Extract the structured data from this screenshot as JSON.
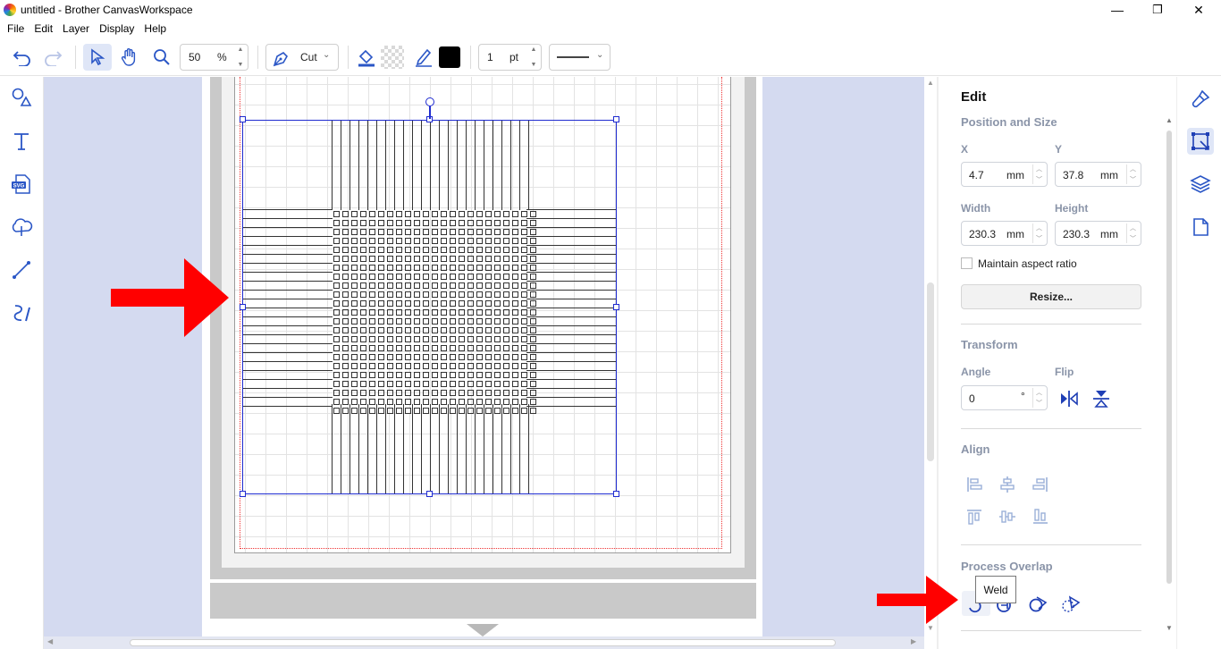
{
  "window": {
    "title": "untitled - Brother CanvasWorkspace",
    "minimize": "—",
    "restore": "❐",
    "close": "✕"
  },
  "menu": [
    "File",
    "Edit",
    "Layer",
    "Display",
    "Help"
  ],
  "toolbar": {
    "zoom_value": "50",
    "zoom_unit": "%",
    "mode_label": "Cut",
    "line_width_value": "1",
    "line_width_unit": "pt",
    "line_color": "#000000"
  },
  "edit_panel": {
    "title": "Edit",
    "position_size": {
      "title": "Position and Size",
      "x_label": "X",
      "x_value": "4.7",
      "x_unit": "mm",
      "y_label": "Y",
      "y_value": "37.8",
      "y_unit": "mm",
      "width_label": "Width",
      "width_value": "230.3",
      "width_unit": "mm",
      "height_label": "Height",
      "height_value": "230.3",
      "height_unit": "mm",
      "aspect_label": "Maintain aspect ratio",
      "resize_label": "Resize..."
    },
    "transform": {
      "title": "Transform",
      "angle_label": "Angle",
      "angle_value": "0",
      "angle_unit": "°",
      "flip_label": "Flip"
    },
    "align": {
      "title": "Align"
    },
    "process_overlap": {
      "title": "Process Overlap",
      "tooltip": "Weld"
    },
    "colors": {
      "accent": "#1f3fb5",
      "disabled": "#9bb0d8",
      "selection": "#1f2bd0",
      "annotation_arrow": "#ff0000"
    }
  },
  "icons": {
    "left_tools": [
      "shapes-icon",
      "text-icon",
      "svg-import-icon",
      "cloud-shape-icon",
      "line-icon",
      "freehand-icon"
    ],
    "right_tools": [
      "paint-icon",
      "edit-transform-icon",
      "layers-icon",
      "page-icon"
    ]
  }
}
